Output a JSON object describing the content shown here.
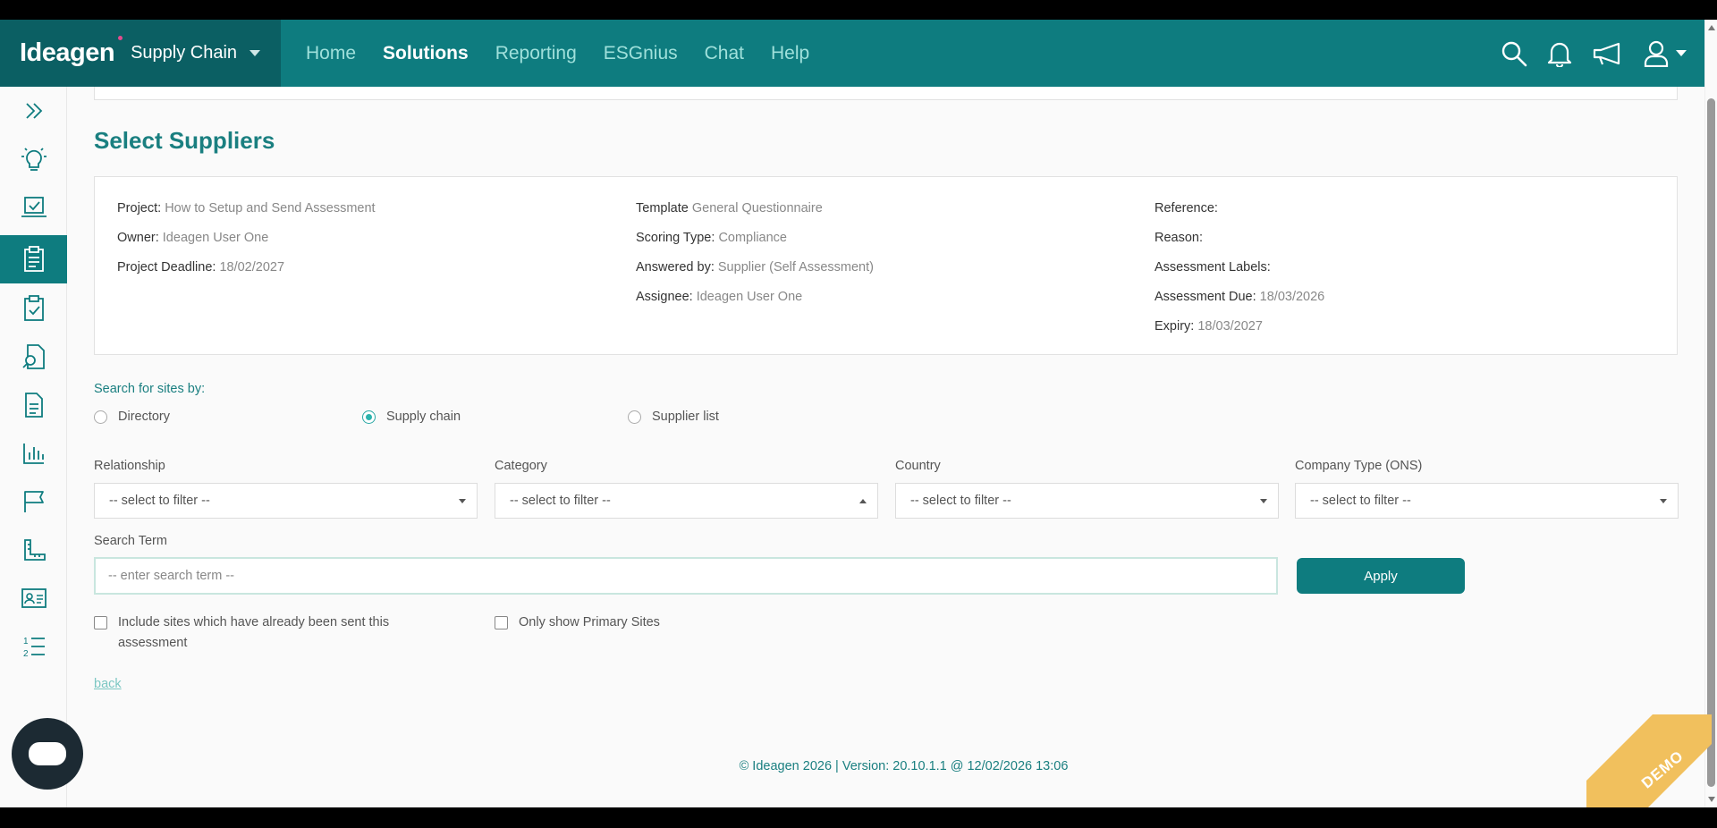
{
  "brand": {
    "logo": "Ideagen",
    "product": "Supply Chain"
  },
  "nav": {
    "links": [
      {
        "label": "Home",
        "active": false
      },
      {
        "label": "Solutions",
        "active": true
      },
      {
        "label": "Reporting",
        "active": false
      },
      {
        "label": "ESGnius",
        "active": false
      },
      {
        "label": "Chat",
        "active": false
      },
      {
        "label": "Help",
        "active": false
      }
    ],
    "icons": [
      "search-icon",
      "bell-icon",
      "megaphone-icon",
      "user-icon"
    ]
  },
  "sidebar": {
    "items": [
      "expand-icon",
      "lightbulb-icon",
      "laptop-check-icon",
      "clipboard-icon",
      "clipboard-check-icon",
      "document-search-icon",
      "document-icon",
      "bar-chart-icon",
      "flag-icon",
      "ruler-icon",
      "id-card-icon",
      "ordered-list-icon"
    ],
    "active_index": 3
  },
  "page": {
    "title": "Select Suppliers"
  },
  "info": {
    "col1": [
      {
        "label": "Project:",
        "value": "How to Setup and Send Assessment"
      },
      {
        "label": "Owner:",
        "value": "Ideagen User One"
      },
      {
        "label": "Project Deadline:",
        "value": "18/02/2027"
      }
    ],
    "col2": [
      {
        "label": "Template",
        "value": "General Questionnaire"
      },
      {
        "label": "Scoring Type:",
        "value": "Compliance"
      },
      {
        "label": "Answered by:",
        "value": "Supplier (Self Assessment)"
      },
      {
        "label": "Assignee:",
        "value": "Ideagen User One"
      }
    ],
    "col3": [
      {
        "label": "Reference:",
        "value": ""
      },
      {
        "label": "Reason:",
        "value": ""
      },
      {
        "label": "Assessment Labels:",
        "value": ""
      },
      {
        "label": "Assessment Due:",
        "value": "18/03/2026"
      },
      {
        "label": "Expiry:",
        "value": "18/03/2027"
      }
    ]
  },
  "search": {
    "label": "Search for sites by:",
    "options": [
      "Directory",
      "Supply chain",
      "Supplier list"
    ],
    "selected": "Supply chain"
  },
  "filters": [
    {
      "label": "Relationship",
      "value": "-- select to filter --"
    },
    {
      "label": "Category",
      "value": "-- select to filter --"
    },
    {
      "label": "Country",
      "value": "-- select to filter --"
    },
    {
      "label": "Company Type (ONS)",
      "value": "-- select to filter --"
    }
  ],
  "term": {
    "label": "Search Term",
    "placeholder": "-- enter search term --",
    "value": ""
  },
  "apply_label": "Apply",
  "checks": {
    "include_sent": "Include sites which have already been sent this assessment",
    "primary_only": "Only show Primary Sites"
  },
  "back_label": "back",
  "footer": "© Ideagen 2026 | Version: 20.10.1.1 @ 12/02/2026 13:06",
  "demo_label": "DEMO",
  "colors": {
    "primary": "#0e7c7f",
    "primary_dark": "#0b5f63",
    "accent_radio": "#2bb3ad",
    "demo_ribbon": "#f1c05d"
  }
}
